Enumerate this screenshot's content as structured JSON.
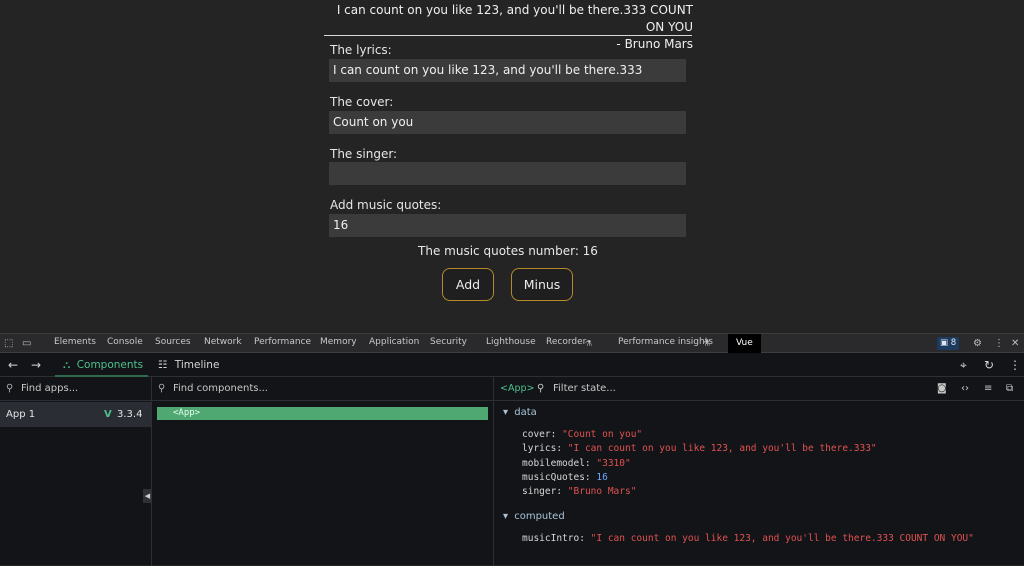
{
  "app": {
    "quote_line1": "I can count on you like 123, and you'll be there.333 COUNT ON YOU",
    "quote_line2": "- Bruno Mars",
    "fields": [
      {
        "label": "The lyrics:",
        "value": "I can count on you like 123, and you'll be there.333"
      },
      {
        "label": "The cover:",
        "value": "Count on you"
      },
      {
        "label": "The singer:",
        "value": ""
      },
      {
        "label": "Add music quotes:",
        "value": "16"
      }
    ],
    "count_text": "The music quotes number: 16",
    "add_label": "Add",
    "minus_label": "Minus"
  },
  "devtools": {
    "tabs": [
      "Elements",
      "Console",
      "Sources",
      "Network",
      "Performance",
      "Memory",
      "Application",
      "Security",
      "Lighthouse",
      "Recorder",
      "Performance insights",
      "Vue"
    ],
    "badge_count": "8",
    "vue": {
      "components_label": "Components",
      "timeline_label": "Timeline",
      "find_apps_placeholder": "Find apps...",
      "find_components_placeholder": "Find components...",
      "selected_component": "<App>",
      "filter_state_placeholder": "Filter state...",
      "app_name": "App 1",
      "vue_version": "3.3.4",
      "tree_item": "<App>",
      "data_heading": "data",
      "computed_heading": "computed",
      "data": [
        {
          "key": "cover",
          "value": "\"Count on you\"",
          "type": "string"
        },
        {
          "key": "lyrics",
          "value": "\"I can count on you like 123, and you'll be there.333\"",
          "type": "string"
        },
        {
          "key": "mobilemodel",
          "value": "\"3310\"",
          "type": "string"
        },
        {
          "key": "musicQuotes",
          "value": "16",
          "type": "number"
        },
        {
          "key": "singer",
          "value": "\"Bruno Mars\"",
          "type": "string"
        }
      ],
      "computed": [
        {
          "key": "musicIntro",
          "value": "\"I can count on you like 123, and you'll be there.333 COUNT ON YOU\"",
          "type": "string"
        }
      ]
    }
  },
  "colors": {
    "vue_green": "#4fc08d",
    "button_border": "#b48a2c",
    "string_value": "#e05252",
    "number_value": "#6fa8ff"
  }
}
